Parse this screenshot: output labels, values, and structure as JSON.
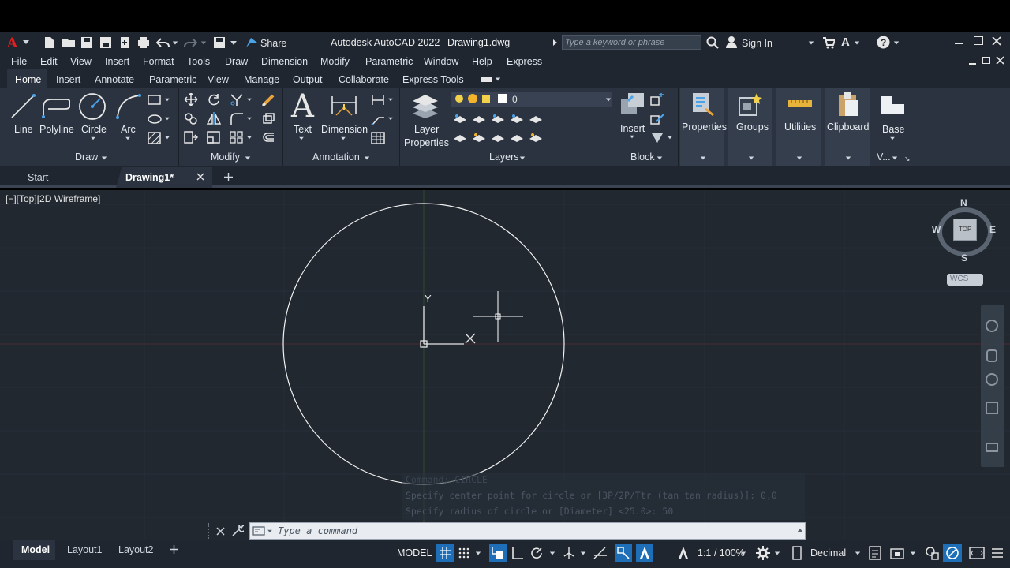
{
  "titlebar": {
    "share_label": "Share",
    "app_title": "Autodesk AutoCAD 2022",
    "file_name": "Drawing1.dwg",
    "search_placeholder": "Type a keyword or phrase",
    "sign_in_label": "Sign In"
  },
  "menubar": {
    "items": [
      "File",
      "Edit",
      "View",
      "Insert",
      "Format",
      "Tools",
      "Draw",
      "Dimension",
      "Modify",
      "Parametric",
      "Window",
      "Help",
      "Express"
    ]
  },
  "ribbon_tabs": {
    "items": [
      "Home",
      "Insert",
      "Annotate",
      "Parametric",
      "View",
      "Manage",
      "Output",
      "Collaborate",
      "Express Tools"
    ],
    "active": "Home"
  },
  "ribbon": {
    "draw": {
      "title": "Draw",
      "line": "Line",
      "polyline": "Polyline",
      "circle": "Circle",
      "arc": "Arc"
    },
    "modify": {
      "title": "Modify"
    },
    "annotation": {
      "title": "Annotation",
      "text": "Text",
      "dimension": "Dimension"
    },
    "layers": {
      "title": "Layers",
      "layer_properties_1": "Layer",
      "layer_properties_2": "Properties",
      "current_layer": "0"
    },
    "block": {
      "title": "Block",
      "insert": "Insert"
    },
    "properties": {
      "label": "Properties"
    },
    "groups": {
      "label": "Groups"
    },
    "utilities": {
      "label": "Utilities"
    },
    "clipboard": {
      "label": "Clipboard"
    },
    "base": {
      "label": "Base",
      "view_short": "V..."
    }
  },
  "doc_tabs": {
    "start": "Start",
    "drawing": "Drawing1*"
  },
  "viewport": {
    "view_label": "[−][Top][2D Wireframe]",
    "compass": {
      "n": "N",
      "s": "S",
      "e": "E",
      "w": "W",
      "top": "TOP"
    },
    "wcs": "WCS",
    "ucs_y": "Y"
  },
  "command": {
    "history": [
      "Command: CIRCLE",
      "Specify center point for circle or [3P/2P/Ttr (tan tan radius)]: 0,0",
      "Specify radius of circle or [Diameter] <25.0>: 50"
    ],
    "placeholder": "Type a command"
  },
  "layout_tabs": {
    "items": [
      "Model",
      "Layout1",
      "Layout2"
    ],
    "active": "Model"
  },
  "statusbar": {
    "model": "MODEL",
    "scale": "1:1 / 100%",
    "units": "Decimal"
  },
  "colors": {
    "accent": "#1e88e5",
    "viewport_bg": "#212830",
    "ribbon_bg": "#2b3340",
    "title_bg": "#1f2630"
  }
}
